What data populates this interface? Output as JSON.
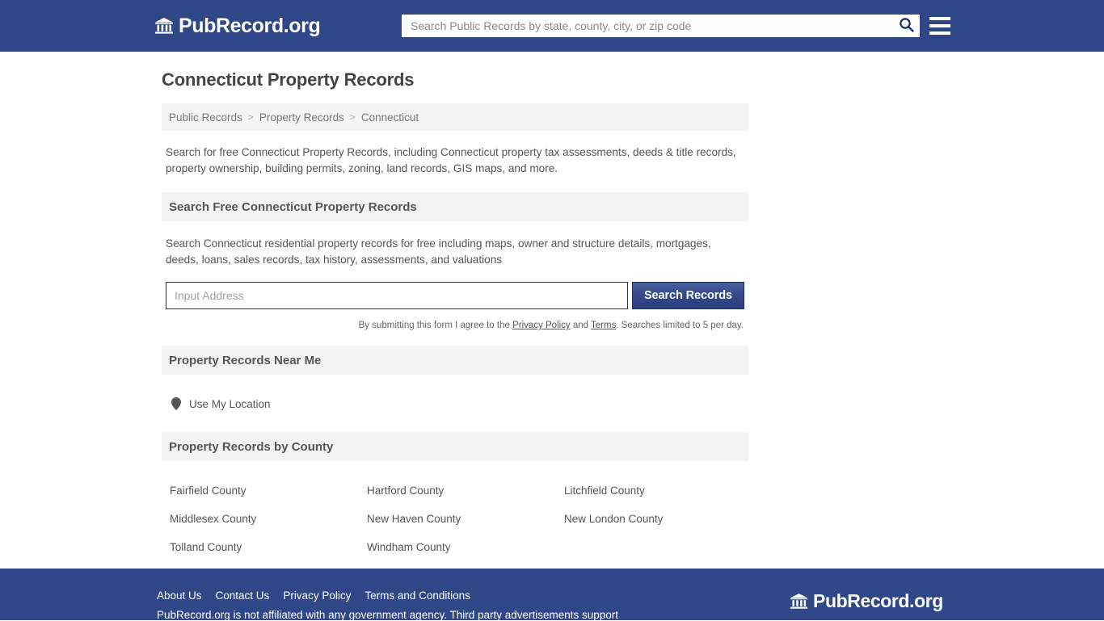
{
  "header": {
    "brand_name": "PubRecord.org",
    "brand_icon": "bank-icon",
    "search_placeholder": "Search Public Records by state, county, city, or zip code",
    "search_value": "",
    "search_icon": "search-icon",
    "menu_icon": "hamburger-menu-icon",
    "bar_color": "#2f4786"
  },
  "page": {
    "title": "Connecticut Property Records",
    "intro": "Search for free Connecticut Property Records, including Connecticut property tax assessments, deeds & title records, property ownership, building permits, zoning, land records, GIS maps, and more."
  },
  "breadcrumb": {
    "items": [
      {
        "label": "Public Records",
        "current": false
      },
      {
        "label": "Property Records",
        "current": false
      },
      {
        "label": "Connecticut",
        "current": true
      }
    ],
    "separator": ">"
  },
  "search_section": {
    "heading": "Search Free Connecticut Property Records",
    "description": "Search Connecticut residential property records for free including maps, owner and structure details, mortgages, deeds, loans, sales records, tax history, assessments, and valuations",
    "input_placeholder": "Input Address",
    "input_value": "",
    "button_label": "Search Records",
    "note_prefix": "By submitting this form I agree to the ",
    "note_privacy": "Privacy Policy",
    "note_and": " and ",
    "note_terms": "Terms",
    "note_suffix": ". Searches limited to 5 per day.",
    "button_color": "#33488a"
  },
  "near_me_section": {
    "heading": "Property Records Near Me",
    "locate_icon": "map-pin-icon",
    "locate_label": "Use My Location"
  },
  "county_section": {
    "heading": "Property Records by County",
    "counties": [
      "Fairfield County",
      "Hartford County",
      "Litchfield County",
      "Middlesex County",
      "New Haven County",
      "New London County",
      "Tolland County",
      "Windham County"
    ]
  },
  "footer": {
    "links": [
      "About Us",
      "Contact Us",
      "Privacy Policy",
      "Terms and Conditions"
    ],
    "disclaimer": "PubRecord.org is not affiliated with any government agency. Third party advertisements support",
    "brand_name": "PubRecord.org",
    "brand_icon": "bank-icon",
    "bar_color": "#2f4786"
  }
}
